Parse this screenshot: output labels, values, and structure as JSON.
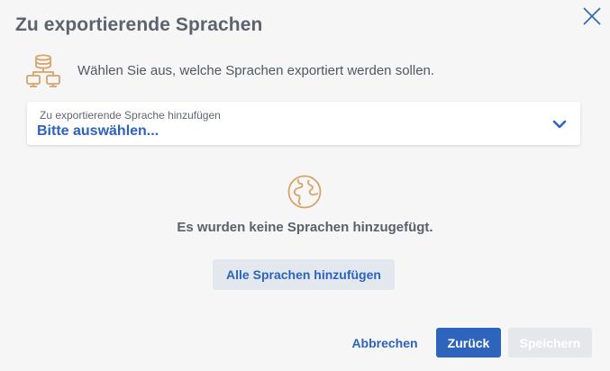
{
  "dialog": {
    "title": "Zu exportierende Sprachen",
    "info_text": "Wählen Sie aus, welche Sprachen exportiert werden sollen.",
    "info_icon": "database-network-icon",
    "close_icon": "close-icon"
  },
  "language_select": {
    "label": "Zu exportierende Sprache hinzufügen",
    "value": "Bitte auswählen...",
    "icon": "chevron-down-icon"
  },
  "empty_state": {
    "icon": "globe-icon",
    "text": "Es wurden keine Sprachen hinzugefügt.",
    "add_all_label": "Alle Sprachen hinzufügen"
  },
  "footer": {
    "cancel_label": "Abbrechen",
    "back_label": "Zurück",
    "save_label": "Speichern"
  },
  "colors": {
    "accent": "#2f64bd",
    "icon_orange": "#d8a36a",
    "background": "#f6f6f6"
  }
}
